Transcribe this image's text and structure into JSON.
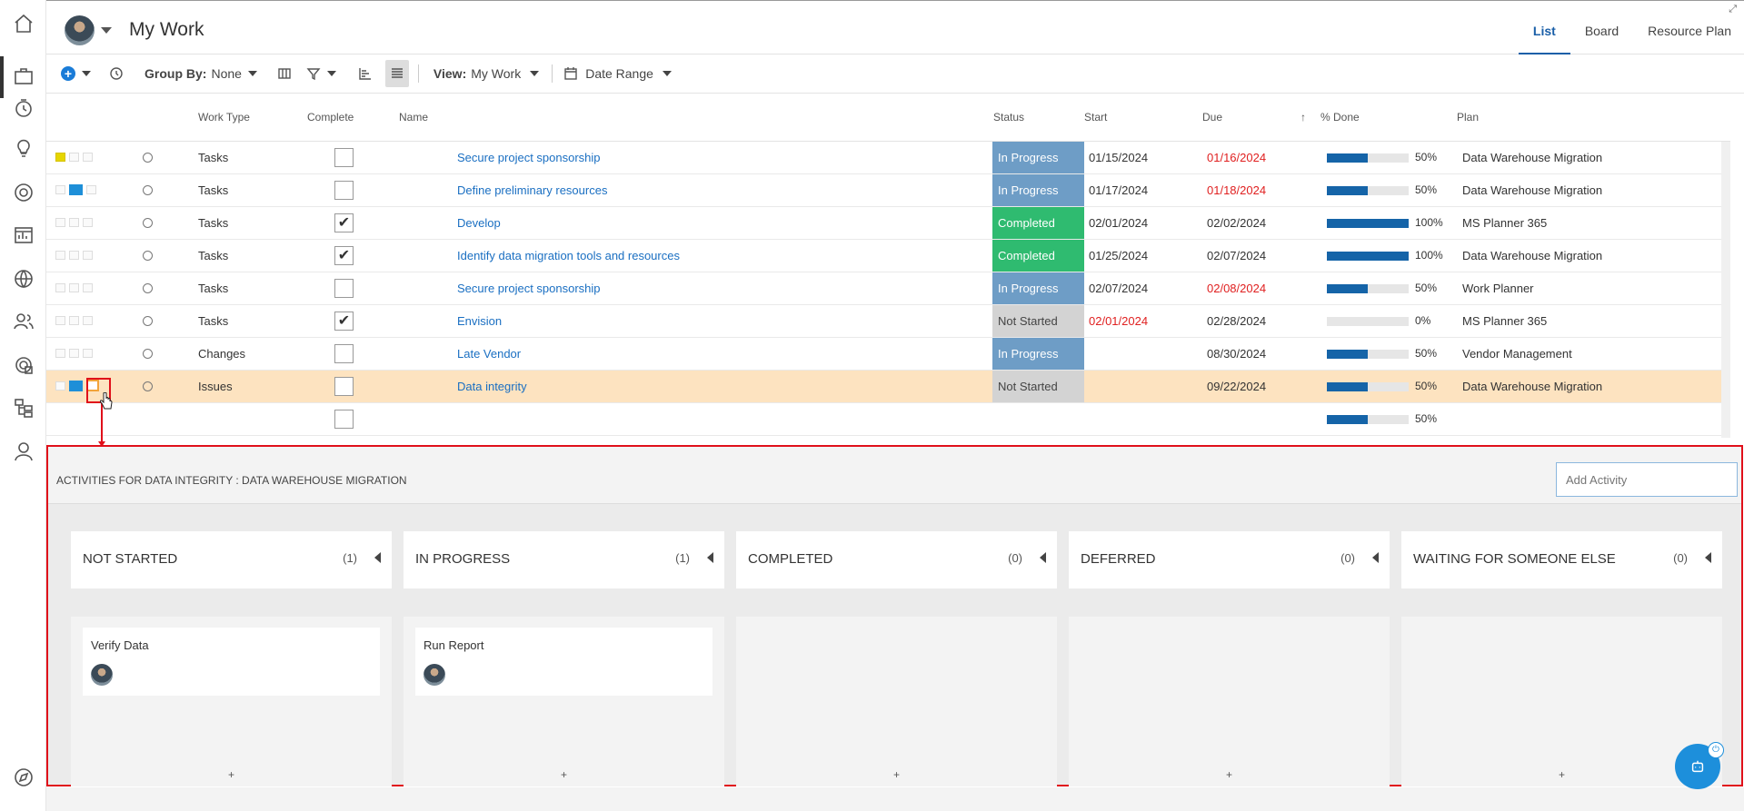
{
  "header": {
    "title": "My Work",
    "views": [
      "List",
      "Board",
      "Resource Plan"
    ],
    "active_view": "List",
    "expand_icon": "⤢"
  },
  "toolbar": {
    "plus_symbol": "+",
    "group_by_label": "Group By:",
    "group_by_value": "None",
    "view_label": "View:",
    "view_value": "My Work",
    "date_range_label": "Date Range"
  },
  "grid": {
    "columns": {
      "work_type": "Work Type",
      "complete": "Complete",
      "name": "Name",
      "status": "Status",
      "start": "Start",
      "due": "Due",
      "sort_icon": "↑",
      "pct_done": "% Done",
      "plan": "Plan"
    },
    "rows": [
      {
        "work_type": "Tasks",
        "checked": "",
        "name": "Secure project sponsorship",
        "status": "In Progress",
        "start": "01/15/2024",
        "due": "01/16/2024",
        "pct_label": "50%",
        "pct": 50,
        "plan": "Data Warehouse Migration"
      },
      {
        "work_type": "Tasks",
        "checked": "",
        "name": "Define preliminary resources",
        "status": "In Progress",
        "start": "01/17/2024",
        "due": "01/18/2024",
        "pct_label": "50%",
        "pct": 50,
        "plan": "Data Warehouse Migration"
      },
      {
        "work_type": "Tasks",
        "checked": "✔",
        "name": "Develop",
        "status": "Completed",
        "start": "02/01/2024",
        "due": "02/02/2024",
        "pct_label": "100%",
        "pct": 100,
        "plan": "MS Planner 365"
      },
      {
        "work_type": "Tasks",
        "checked": "✔",
        "name": "Identify data migration tools and resources",
        "status": "Completed",
        "start": "01/25/2024",
        "due": "02/07/2024",
        "pct_label": "100%",
        "pct": 100,
        "plan": "Data Warehouse Migration"
      },
      {
        "work_type": "Tasks",
        "checked": "",
        "name": "Secure project sponsorship",
        "status": "In Progress",
        "start": "02/07/2024",
        "due": "02/08/2024",
        "pct_label": "50%",
        "pct": 50,
        "plan": "Work Planner"
      },
      {
        "work_type": "Tasks",
        "checked": "✔",
        "name": "Envision",
        "status": "Not Started",
        "start": "02/01/2024",
        "due": "02/28/2024",
        "pct_label": "0%",
        "pct": 0,
        "plan": "MS Planner 365"
      },
      {
        "work_type": "Changes",
        "checked": "",
        "name": "Late Vendor",
        "status": "In Progress",
        "start": "",
        "due": "08/30/2024",
        "pct_label": "50%",
        "pct": 50,
        "plan": "Vendor Management"
      },
      {
        "work_type": "Issues",
        "checked": "",
        "name": "Data integrity",
        "status": "Not Started",
        "start": "",
        "due": "09/22/2024",
        "pct_label": "50%",
        "pct": 50,
        "plan": "Data Warehouse Migration"
      },
      {
        "work_type": "",
        "checked": "",
        "name": "",
        "status": "",
        "start": "",
        "due": "",
        "pct_label": "50%",
        "pct": 50,
        "plan": ""
      }
    ]
  },
  "activities": {
    "title": "ACTIVITIES FOR DATA INTEGRITY : DATA WAREHOUSE MIGRATION",
    "add_placeholder": "Add Activity",
    "columns": [
      {
        "name": "NOT STARTED",
        "count": "(1)",
        "card": "Verify Data",
        "plus": "+"
      },
      {
        "name": "IN PROGRESS",
        "count": "(1)",
        "card": "Run Report",
        "plus": "+"
      },
      {
        "name": "COMPLETED",
        "count": "(0)",
        "card": "",
        "plus": "+"
      },
      {
        "name": "DEFERRED",
        "count": "(0)",
        "card": "",
        "plus": "+"
      },
      {
        "name": "WAITING FOR SOMEONE ELSE",
        "count": "(0)",
        "card": "",
        "plus": "+"
      }
    ]
  },
  "bot": {
    "power_symbol": "⏻"
  },
  "colors": {
    "accent": "#1a5fa8",
    "in_progress": "#6e9dc6",
    "completed": "#2fbb70",
    "not_started": "#d3d3d3",
    "overdue": "#e02020",
    "highlight_row": "#fde3c0",
    "annotation": "#e0101a"
  }
}
